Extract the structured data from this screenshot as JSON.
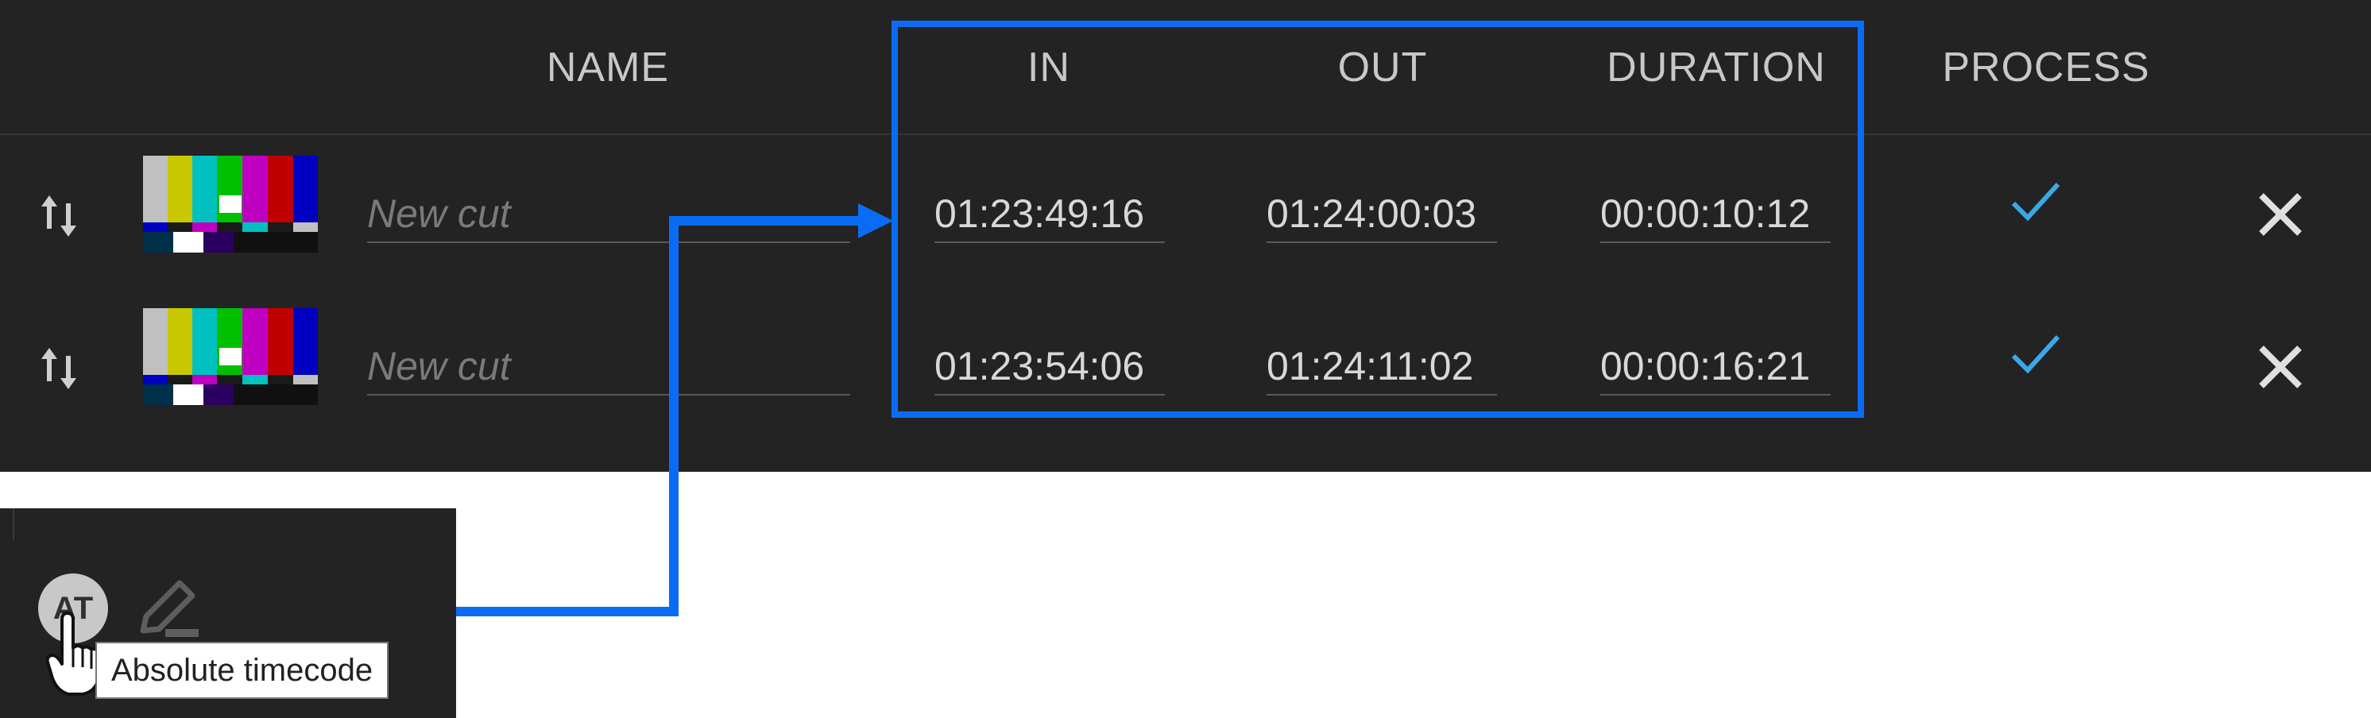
{
  "columns": {
    "name": "NAME",
    "in": "IN",
    "out": "OUT",
    "duration": "DURATION",
    "process": "PROCESS"
  },
  "rows": [
    {
      "name_placeholder": "New cut",
      "in": "01:23:49:16",
      "out": "01:24:00:03",
      "duration": "00:00:10:12"
    },
    {
      "name_placeholder": "New cut",
      "in": "01:23:54:06",
      "out": "01:24:11:02",
      "duration": "00:00:16:21"
    }
  ],
  "toolbar": {
    "at_label": "AT",
    "tooltip": "Absolute timecode"
  },
  "colors": {
    "background": "#232323",
    "highlight": "#0a6cf5",
    "check": "#3aa8e8",
    "text": "#d8d8d8"
  },
  "icons": {
    "sort": "swap-vertical-icon",
    "process": "check-icon",
    "remove": "close-icon",
    "edit": "edit-pencil-icon",
    "cursor": "hand-pointer-icon"
  }
}
